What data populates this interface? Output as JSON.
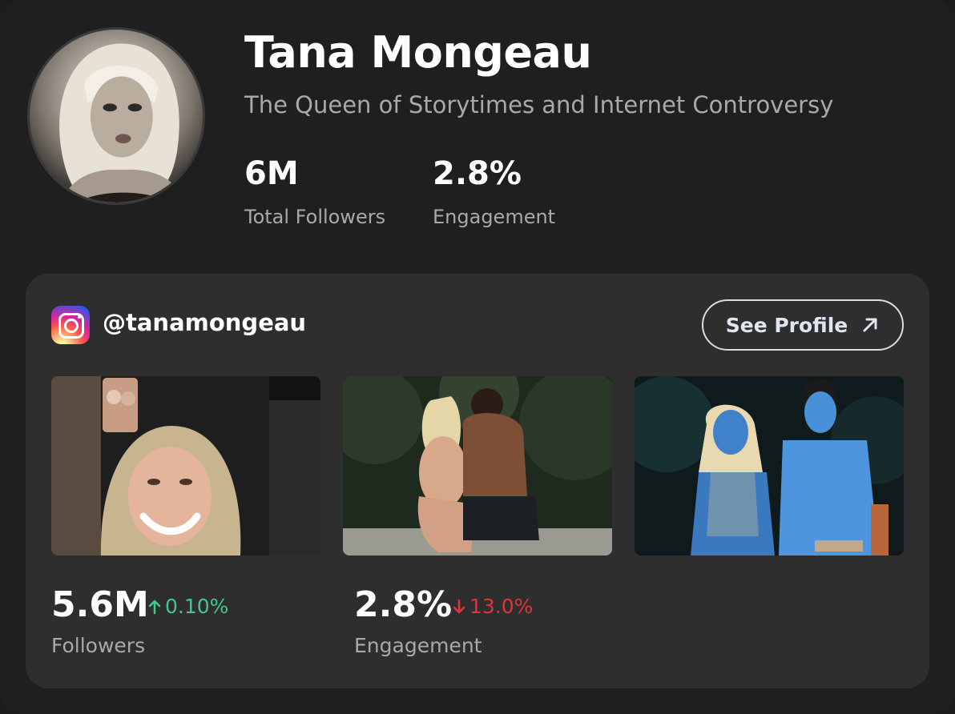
{
  "profile": {
    "name": "Tana Mongeau",
    "tagline": "The Queen of Storytimes and Internet Controversy",
    "stats": [
      {
        "value": "6M",
        "label": "Total Followers"
      },
      {
        "value": "2.8%",
        "label": "Engagement"
      }
    ]
  },
  "instagram": {
    "icon": "instagram-icon",
    "handle": "@tanamongeau",
    "see_profile_label": "See Profile",
    "see_profile_icon": "arrow-up-right-icon",
    "posts": [
      {
        "name": "facetime-selfie"
      },
      {
        "name": "couple-forest"
      },
      {
        "name": "avatar-costume"
      }
    ],
    "metrics": [
      {
        "value": "5.6M",
        "delta": "0.10%",
        "direction": "up",
        "label": "Followers"
      },
      {
        "value": "2.8%",
        "delta": "13.0%",
        "direction": "down",
        "label": "Engagement"
      }
    ]
  },
  "colors": {
    "background": "#1f1f1f",
    "panel": "#2e2e2e",
    "positive": "#3fc98e",
    "negative": "#e0333a",
    "muted_text": "#a9a9a9"
  }
}
